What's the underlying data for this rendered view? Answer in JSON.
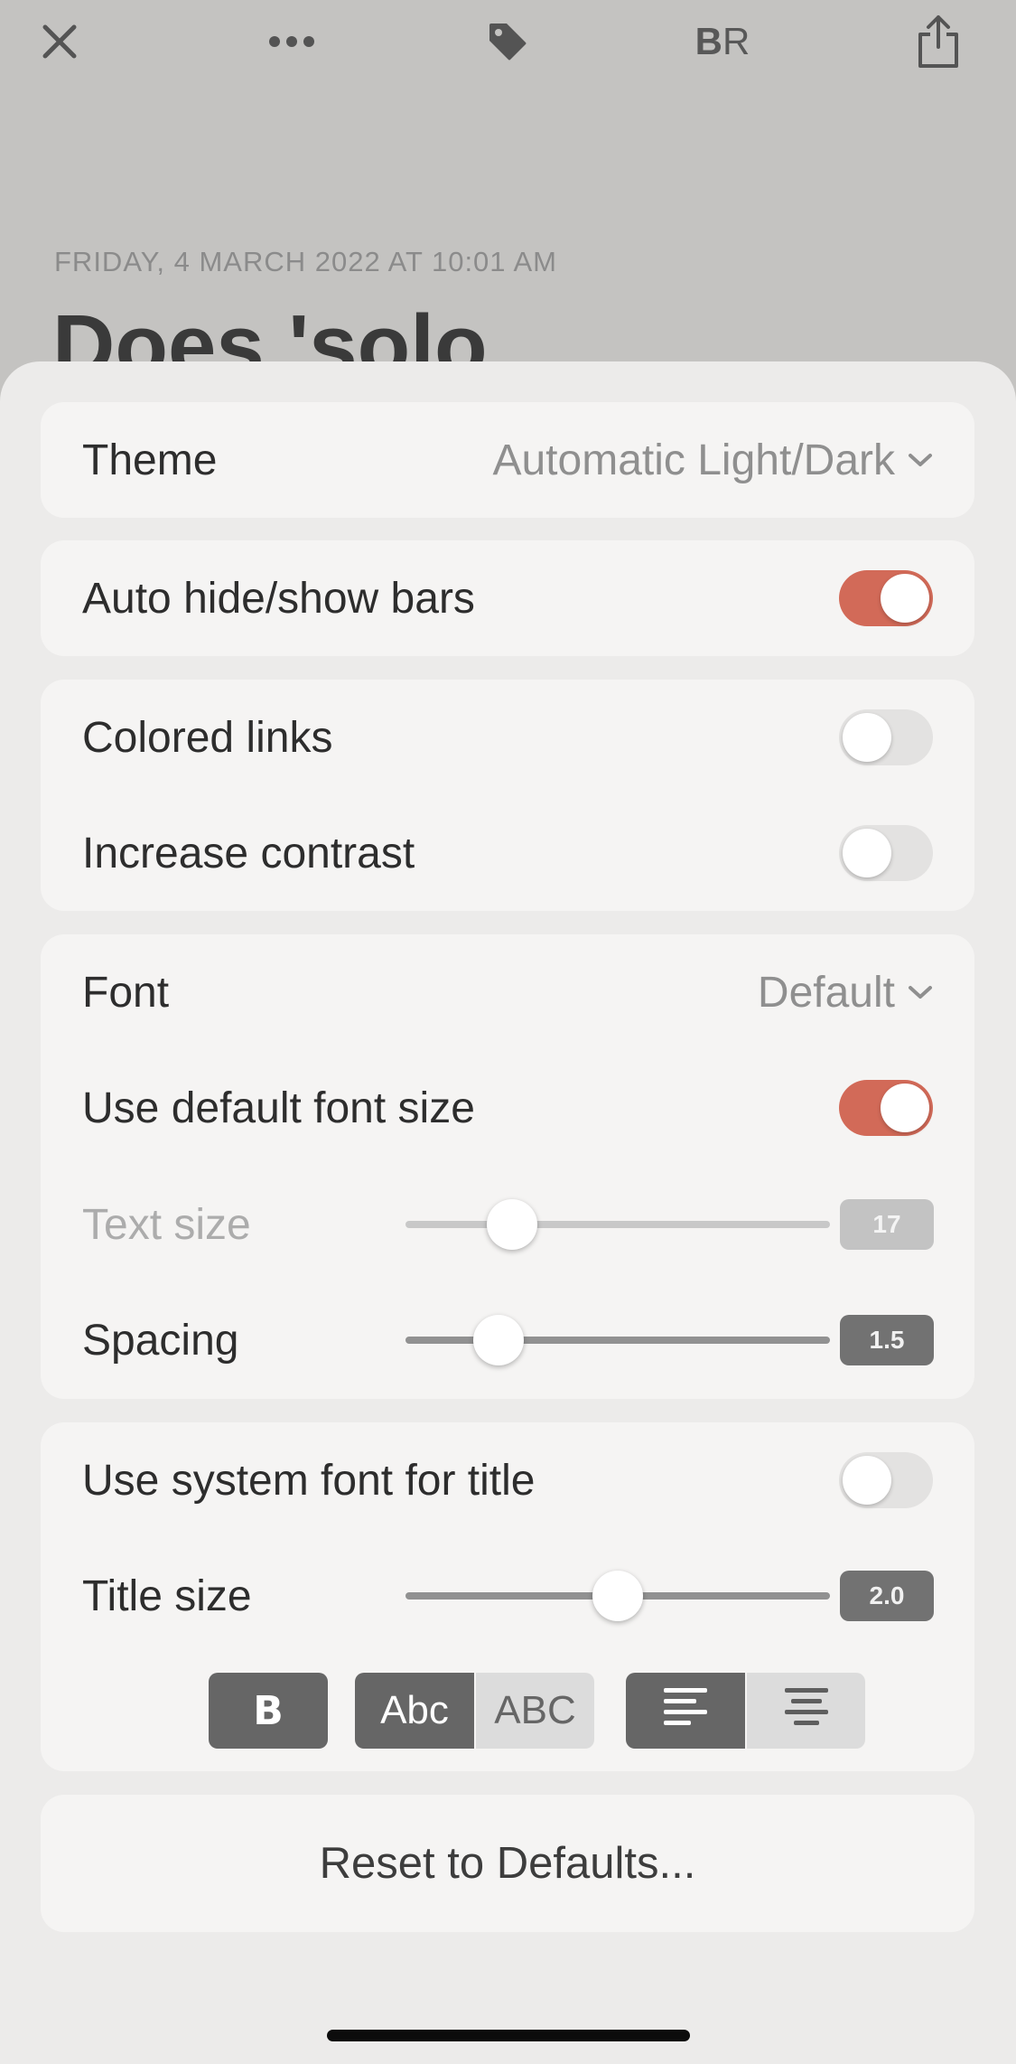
{
  "toolbar": {
    "icons": [
      "close-icon",
      "more-icon",
      "tag-icon",
      "reader-br-icon",
      "share-icon"
    ],
    "br_bold": "B",
    "br_regular": "R"
  },
  "article": {
    "date": "FRIDAY, 4 MARCH 2022 AT 10:01 AM",
    "title": "Does 'solo"
  },
  "settings": {
    "theme": {
      "label": "Theme",
      "value": "Automatic Light/Dark"
    },
    "auto_hide": {
      "label": "Auto hide/show bars",
      "on": true
    },
    "colored_links": {
      "label": "Colored links",
      "on": false
    },
    "increase_contrast": {
      "label": "Increase contrast",
      "on": false
    },
    "font": {
      "label": "Font",
      "value": "Default"
    },
    "default_font_size": {
      "label": "Use default font size",
      "on": true
    },
    "text_size": {
      "label": "Text size",
      "value": "17",
      "level": 0.25,
      "disabled": true
    },
    "spacing": {
      "label": "Spacing",
      "value": "1.5",
      "level": 0.22
    },
    "system_font_title": {
      "label": "Use system font for title",
      "on": false
    },
    "title_size": {
      "label": "Title size",
      "value": "2.0",
      "level": 0.5
    },
    "title_style_buttons": {
      "bold": "B",
      "case_title": "Abc",
      "case_upper": "ABC"
    },
    "alignment_buttons": [
      "align-left-icon",
      "align-center-icon"
    ],
    "reset_label": "Reset to Defaults..."
  },
  "colors": {
    "accent": "#d26a58",
    "sheet": "#ecebea",
    "card": "#f5f4f3",
    "dimmed_background": "#c4c3c1"
  }
}
